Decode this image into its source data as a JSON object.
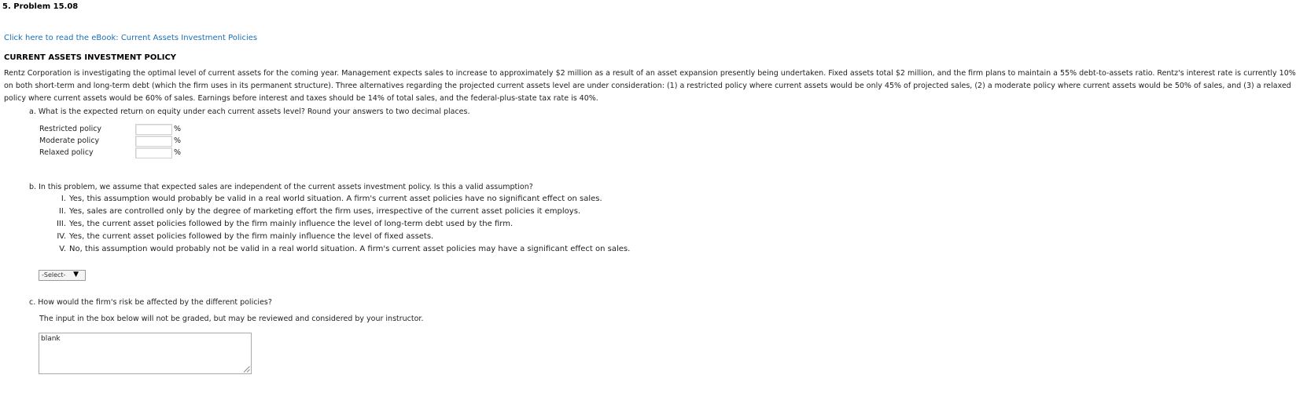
{
  "problem": {
    "title": "5. Problem 15.08",
    "ebook_link": "Click here to read the eBook: Current Assets Investment Policies",
    "section_heading": "CURRENT ASSETS INVESTMENT POLICY",
    "intro": "Rentz Corporation is investigating the optimal level of current assets for the coming year. Management expects sales to increase to approximately $2 million as a result of an asset expansion presently being undertaken. Fixed assets total $2 million, and the firm plans to maintain a 55% debt-to-assets ratio. Rentz's interest rate is currently 10% on both short-term and long-term debt (which the firm uses in its permanent structure). Three alternatives regarding the projected current assets level are under consideration: (1) a restricted policy where current assets would be only 45% of projected sales, (2) a moderate policy where current assets would be 50% of sales, and (3) a relaxed policy where current assets would be 60% of sales. Earnings before interest and taxes should be 14% of total sales, and the federal-plus-state tax rate is 40%."
  },
  "part_a": {
    "question": "a. What is the expected return on equity under each current assets level? Round your answers to two decimal places.",
    "rows": [
      {
        "label": "Restricted policy",
        "value": "",
        "unit": "%"
      },
      {
        "label": "Moderate policy",
        "value": "",
        "unit": "%"
      },
      {
        "label": "Relaxed policy",
        "value": "",
        "unit": "%"
      }
    ]
  },
  "part_b": {
    "question": "b. In this problem, we assume that expected sales are independent of the current assets investment policy. Is this a valid assumption?",
    "options": [
      {
        "num": "I.",
        "text": "Yes, this assumption would probably be valid in a real world situation. A firm's current asset policies have no significant effect on sales."
      },
      {
        "num": "II.",
        "text": "Yes, sales are controlled only by the degree of marketing effort the firm uses, irrespective of the current asset policies it employs."
      },
      {
        "num": "III.",
        "text": "Yes, the current asset policies followed by the firm mainly influence the level of long-term debt used by the firm."
      },
      {
        "num": "IV.",
        "text": "Yes, the current asset policies followed by the firm mainly influence the level of fixed assets."
      },
      {
        "num": "V.",
        "text": "No, this assumption would probably not be valid in a real world situation. A firm's current asset policies may have a significant effect on sales."
      }
    ],
    "select_value": "-Select-",
    "select_arrow_icon": "triangle-down-icon"
  },
  "part_c": {
    "question": "c. How would the firm's risk be affected by the different policies?",
    "note": "The input in the box below will not be graded, but may be reviewed and considered by your instructor.",
    "textarea_value": "blank"
  },
  "colors": {
    "link": "#1a6fb5",
    "text": "#222222"
  }
}
